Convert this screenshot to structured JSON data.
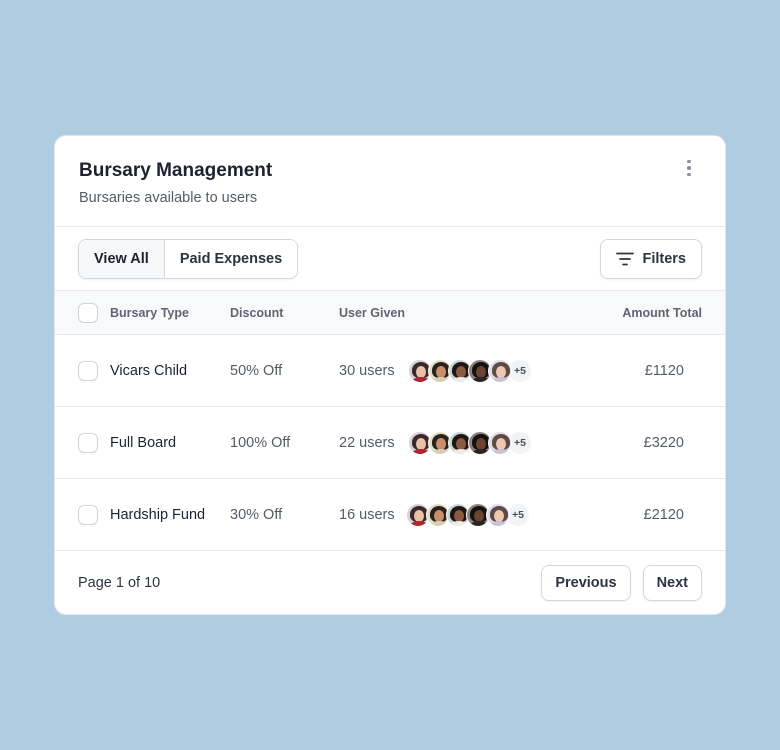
{
  "header": {
    "title": "Bursary Management",
    "subtitle": "Bursaries available to users",
    "menu_icon": "more-vertical-icon"
  },
  "toolbar": {
    "tabs": [
      {
        "label": "View All",
        "active": true
      },
      {
        "label": "Paid Expenses",
        "active": false
      }
    ],
    "filters_label": "Filters",
    "filters_icon": "filter-lines-icon"
  },
  "table": {
    "columns": {
      "type": "Bursary Type",
      "discount": "Discount",
      "users": "User Given",
      "amount": "Amount Total"
    },
    "rows": [
      {
        "type": "Vicars Child",
        "discount": "50% Off",
        "users": "30 users",
        "more": "+5",
        "amount": "£1120"
      },
      {
        "type": "Full Board",
        "discount": "100% Off",
        "users": "22 users",
        "more": "+5",
        "amount": "£3220"
      },
      {
        "type": "Hardship Fund",
        "discount": "30% Off",
        "users": "16 users",
        "more": "+5",
        "amount": "£2120"
      }
    ]
  },
  "footer": {
    "page_info": "Page 1 of 10",
    "previous_label": "Previous",
    "next_label": "Next"
  },
  "colors": {
    "background": "#b0cce0",
    "card": "#ffffff",
    "border": "#e6e8eb",
    "text_primary": "#1d2230",
    "text_muted": "#555b66"
  }
}
